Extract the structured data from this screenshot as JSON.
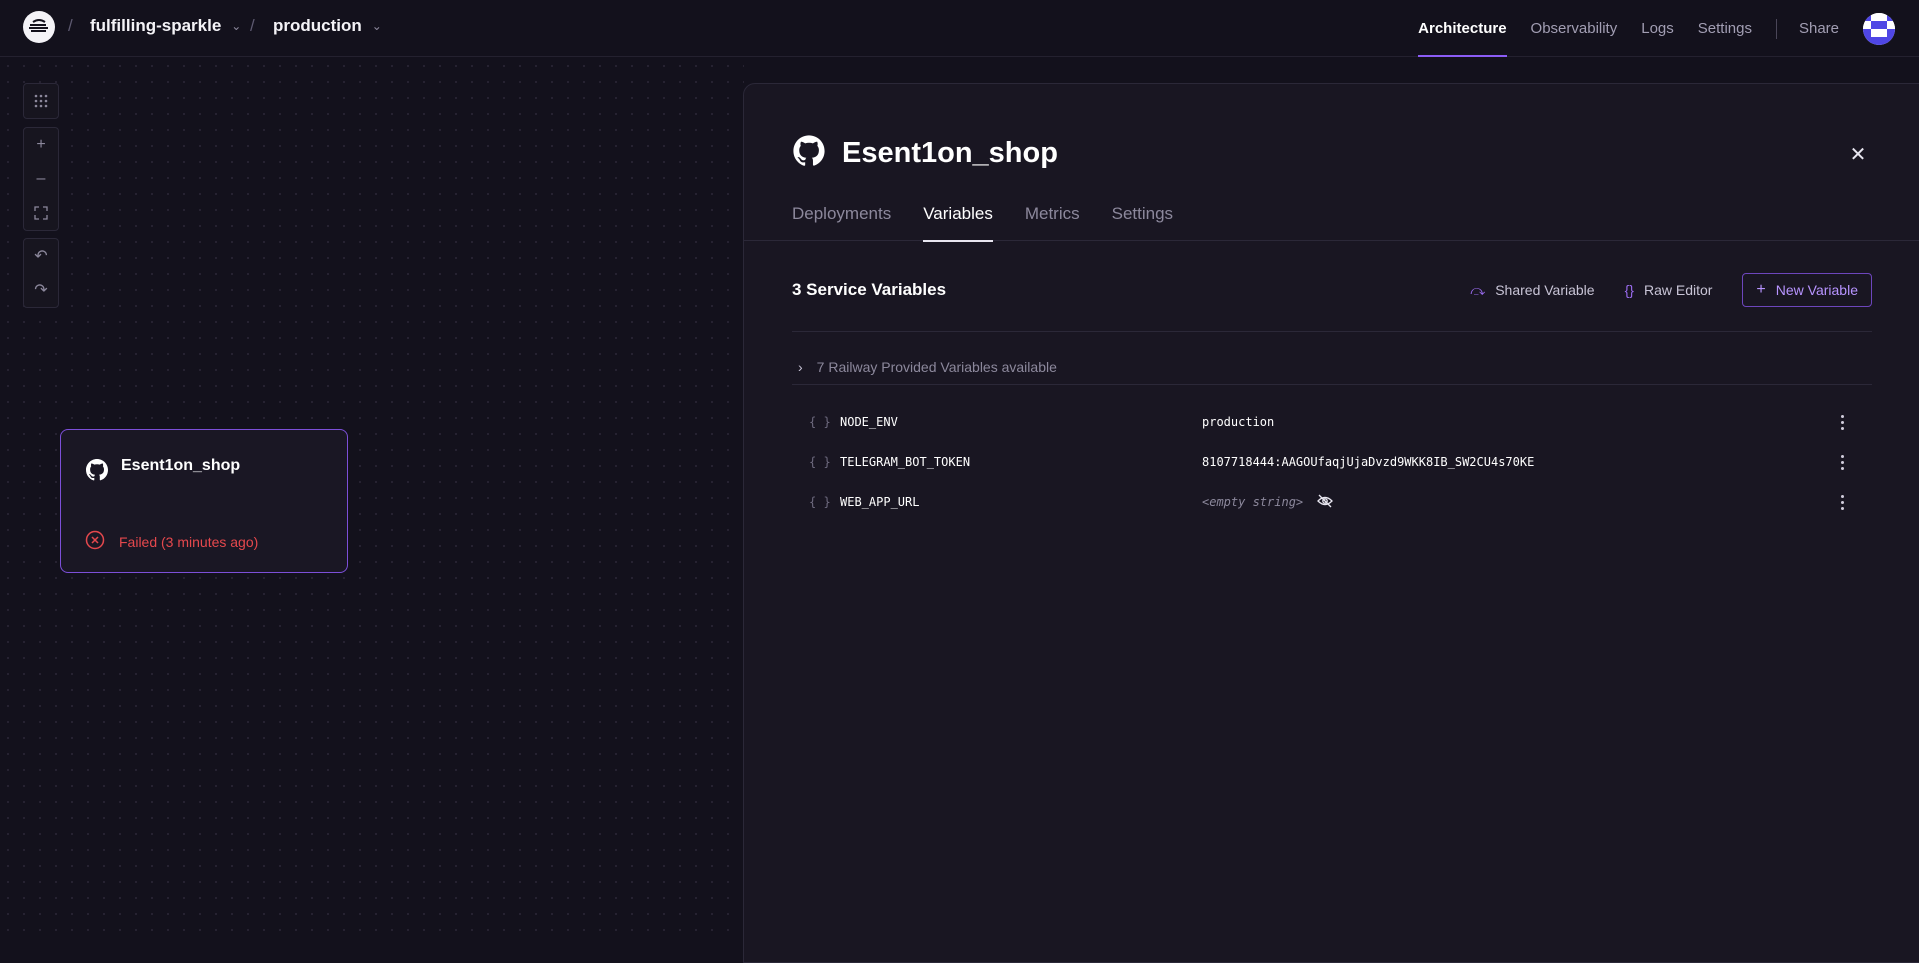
{
  "topbar": {
    "logo_icon": "railway-logo-icon",
    "project": "fulfilling-sparkle",
    "environment": "production",
    "nav": [
      "Architecture",
      "Observability",
      "Logs",
      "Settings"
    ],
    "share": "Share",
    "accent": "#8b5cf6"
  },
  "canvas": {
    "tools": [
      "grid-icon",
      "zoom-in-icon",
      "zoom-out-icon",
      "fit-view-icon",
      "undo-icon",
      "redo-icon"
    ],
    "service": {
      "name": "Esent1on_shop",
      "icon": "github-icon",
      "status": "Failed (3 minutes ago)",
      "status_color": "#e5484d"
    }
  },
  "panel": {
    "title": "Esent1on_shop",
    "tabs": [
      "Deployments",
      "Variables",
      "Metrics",
      "Settings"
    ],
    "active_tab": "Variables",
    "vars_count": "3 Service Variables",
    "actions": {
      "shared": "Shared Variable",
      "raw": "Raw Editor",
      "new": "New Variable"
    },
    "provided": "7 Railway Provided Variables available",
    "variables": [
      {
        "key": "NODE_ENV",
        "value": "production"
      },
      {
        "key": "TELEGRAM_BOT_TOKEN",
        "value": "8107718444:AAGOUfaqjUjaDvzd9WKK8IB_SW2CU4s70KE"
      },
      {
        "key": "WEB_APP_URL",
        "value": "<empty string>"
      }
    ]
  }
}
